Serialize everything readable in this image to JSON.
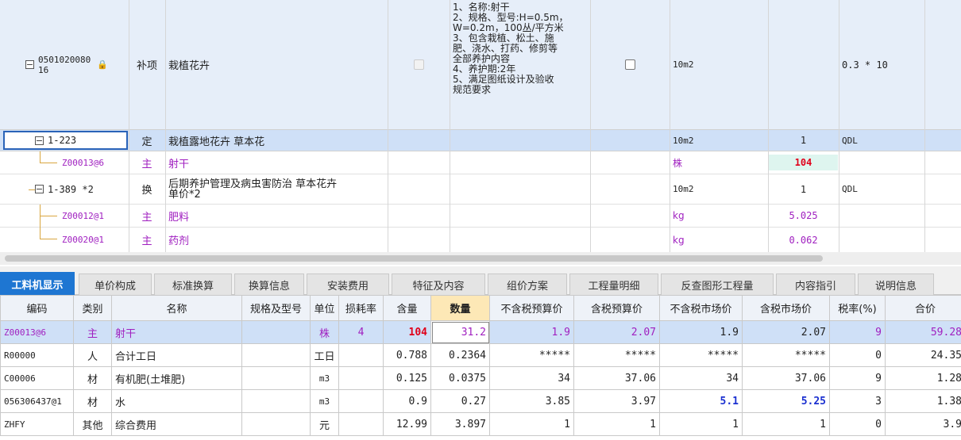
{
  "upper_grid": {
    "rows": [
      {
        "code": "0501020080\n16",
        "type": "补项",
        "name": "栽植花卉",
        "features": "1、名称:射干\n2、规格、型号:H=0.5m，\nW=0.2m，100丛/平方米\n3、包含栽植、松土、施\n肥、浇水、打药、修剪等\n全部养护内容\n4、养护期:2年\n5、满足图纸设计及验收\n规范要求",
        "unit": "10m2",
        "expression": "0.3 * 10"
      },
      {
        "code": "1-223",
        "type": "定",
        "name": "栽植露地花卉 草本花",
        "unit": "10m2",
        "qty": "1",
        "qty_code": "QDL"
      },
      {
        "code": "Z00013@6",
        "type": "主",
        "name": "射干",
        "unit": "株",
        "qty": "104"
      },
      {
        "code": "1-389 *2",
        "type": "换",
        "name": "后期养护管理及病虫害防治 草本花卉\n单价*2",
        "unit": "10m2",
        "qty": "1",
        "qty_code": "QDL"
      },
      {
        "code": "Z00012@1",
        "type": "主",
        "name": "肥料",
        "unit": "kg",
        "qty": "5.025"
      },
      {
        "code": "Z00020@1",
        "type": "主",
        "name": "药剂",
        "unit": "kg",
        "qty": "0.062"
      }
    ]
  },
  "tabs": [
    "工料机显示",
    "单价构成",
    "标准换算",
    "换算信息",
    "安装费用",
    "特征及内容",
    "组价方案",
    "工程量明细",
    "反查图形工程量",
    "内容指引",
    "说明信息"
  ],
  "lower_table": {
    "headers": [
      "编码",
      "类别",
      "名称",
      "规格及型号",
      "单位",
      "损耗率",
      "含量",
      "数量",
      "不含税预算价",
      "含税预算价",
      "不含税市场价",
      "含税市场价",
      "税率(%)",
      "合价"
    ],
    "rows": [
      [
        "Z00013@6",
        "主",
        "射干",
        "",
        "株",
        "4",
        "104",
        "31.2",
        "1.9",
        "2.07",
        "1.9",
        "2.07",
        "9",
        "59.28"
      ],
      [
        "R00000",
        "人",
        "合计工日",
        "",
        "工日",
        "",
        "0.788",
        "0.2364",
        "*****",
        "*****",
        "*****",
        "*****",
        "0",
        "24.35"
      ],
      [
        "C00006",
        "材",
        "有机肥(土堆肥)",
        "",
        "m3",
        "",
        "0.125",
        "0.0375",
        "34",
        "37.06",
        "34",
        "37.06",
        "9",
        "1.28"
      ],
      [
        "056306437@1",
        "材",
        "水",
        "",
        "m3",
        "",
        "0.9",
        "0.27",
        "3.85",
        "3.97",
        "5.1",
        "5.25",
        "3",
        "1.38"
      ],
      [
        "ZHFY",
        "其他",
        "综合费用",
        "",
        "元",
        "",
        "12.99",
        "3.897",
        "1",
        "1",
        "1",
        "1",
        "0",
        "3.9"
      ]
    ]
  },
  "colors": {
    "tab_active": "#1e76d2",
    "selected_row": "#cfe0f7",
    "material_text": "#a020c0",
    "highlight_red": "#e0001a",
    "highlight_blue": "#1a2fd0"
  }
}
